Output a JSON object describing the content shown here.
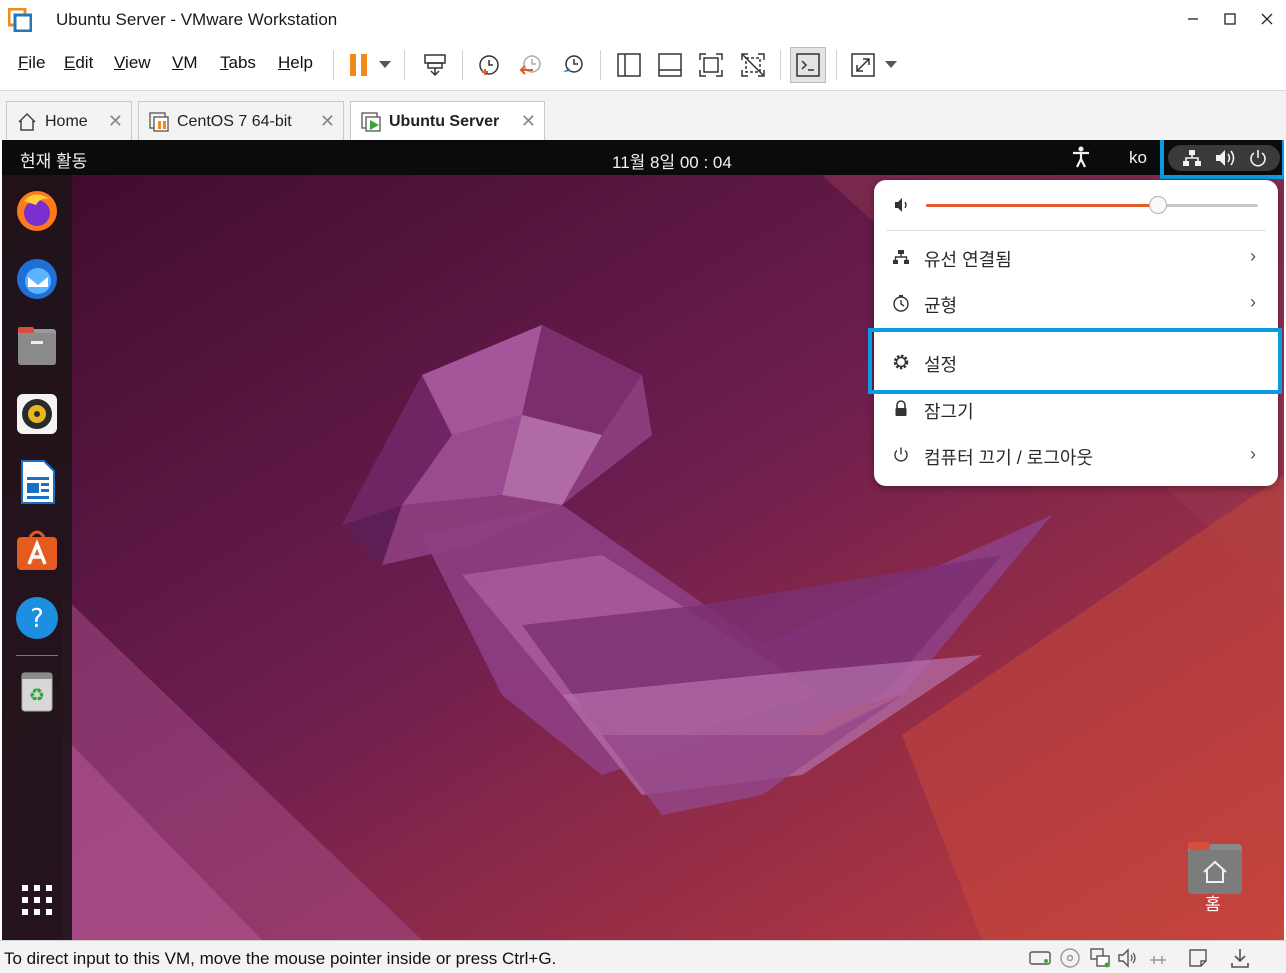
{
  "window": {
    "title": "Ubuntu Server - VMware Workstation"
  },
  "menu": [
    {
      "label_u": "F",
      "label_rest": "ile"
    },
    {
      "label_u": "E",
      "label_rest": "dit"
    },
    {
      "label_u": "V",
      "label_rest": "iew"
    },
    {
      "label_u": "V",
      "label_rest": "M"
    },
    {
      "label_u": "T",
      "label_rest": "abs"
    },
    {
      "label_u": "H",
      "label_rest": "elp"
    }
  ],
  "tabs": [
    {
      "label": "Home"
    },
    {
      "label": "CentOS 7 64-bit"
    },
    {
      "label": "Ubuntu Server"
    }
  ],
  "guest": {
    "activities": "현재 활동",
    "clock": "11월 8일  00 : 04",
    "lang": "ko",
    "desktop_home_label": "홈"
  },
  "quick_settings": {
    "volume_level": 0.7,
    "items": [
      {
        "label": "유선 연결됨",
        "icon": "network-icon",
        "has_submenu": true
      },
      {
        "label": "균형",
        "icon": "power-mode-icon",
        "has_submenu": true
      },
      {
        "label": "설정",
        "icon": "settings-gear-icon",
        "has_submenu": false
      },
      {
        "label": "잠그기",
        "icon": "lock-icon",
        "has_submenu": false
      },
      {
        "label": "컴퓨터 끄기 / 로그아웃",
        "icon": "power-icon",
        "has_submenu": true
      }
    ]
  },
  "dock": [
    "firefox-icon",
    "thunderbird-icon",
    "files-icon",
    "rhythmbox-icon",
    "libreoffice-writer-icon",
    "software-center-icon",
    "help-icon",
    "trash-icon",
    "app-grid-icon"
  ],
  "statusbar": {
    "message": "To direct input to this VM, move the mouse pointer inside or press Ctrl+G."
  },
  "colors": {
    "highlight": "#0a9be0",
    "accent": "#e05a2a"
  }
}
